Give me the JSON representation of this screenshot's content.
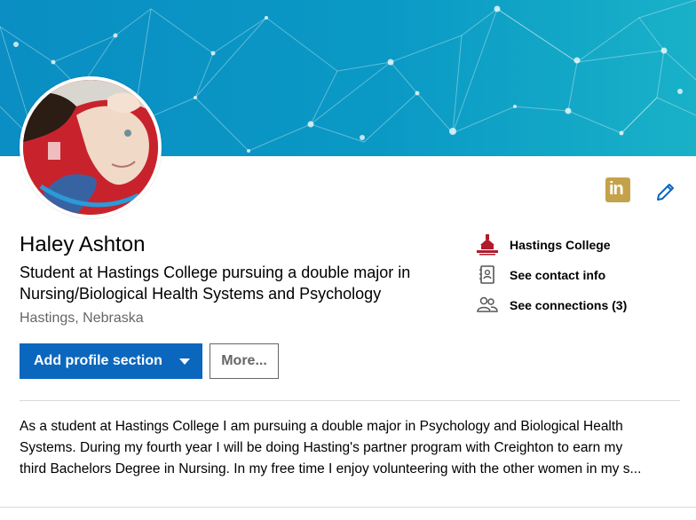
{
  "profile": {
    "name": "Haley Ashton",
    "headline": "Student at Hastings College pursuing a double major in Nursing/Biological Health Systems and Psychology",
    "location": "Hastings, Nebraska"
  },
  "actions": {
    "add_section_label": "Add profile section",
    "more_label": "More..."
  },
  "sidebar": {
    "school": "Hastings College",
    "contact": "See contact info",
    "connections": "See connections (3)"
  },
  "icons": {
    "linkedin": "linkedin-icon",
    "edit": "pencil-icon",
    "school": "hastings-college-logo",
    "contact": "address-book-icon",
    "connections": "people-icon"
  },
  "summary": {
    "line1": "As a student at Hastings College I am pursuing a double major in Psychology and Biological Health",
    "line2": "Systems. During my fourth year I will be doing Hasting's partner program with Creighton to earn my",
    "line3": "third Bachelors Degree in Nursing. In my free time I enjoy volunteering with the other women in my s..."
  },
  "colors": {
    "banner": "#0a93c4",
    "primary_button": "#0a67bd",
    "linkedin_gold": "#c4a24b",
    "edit_blue": "#0a66c2"
  }
}
